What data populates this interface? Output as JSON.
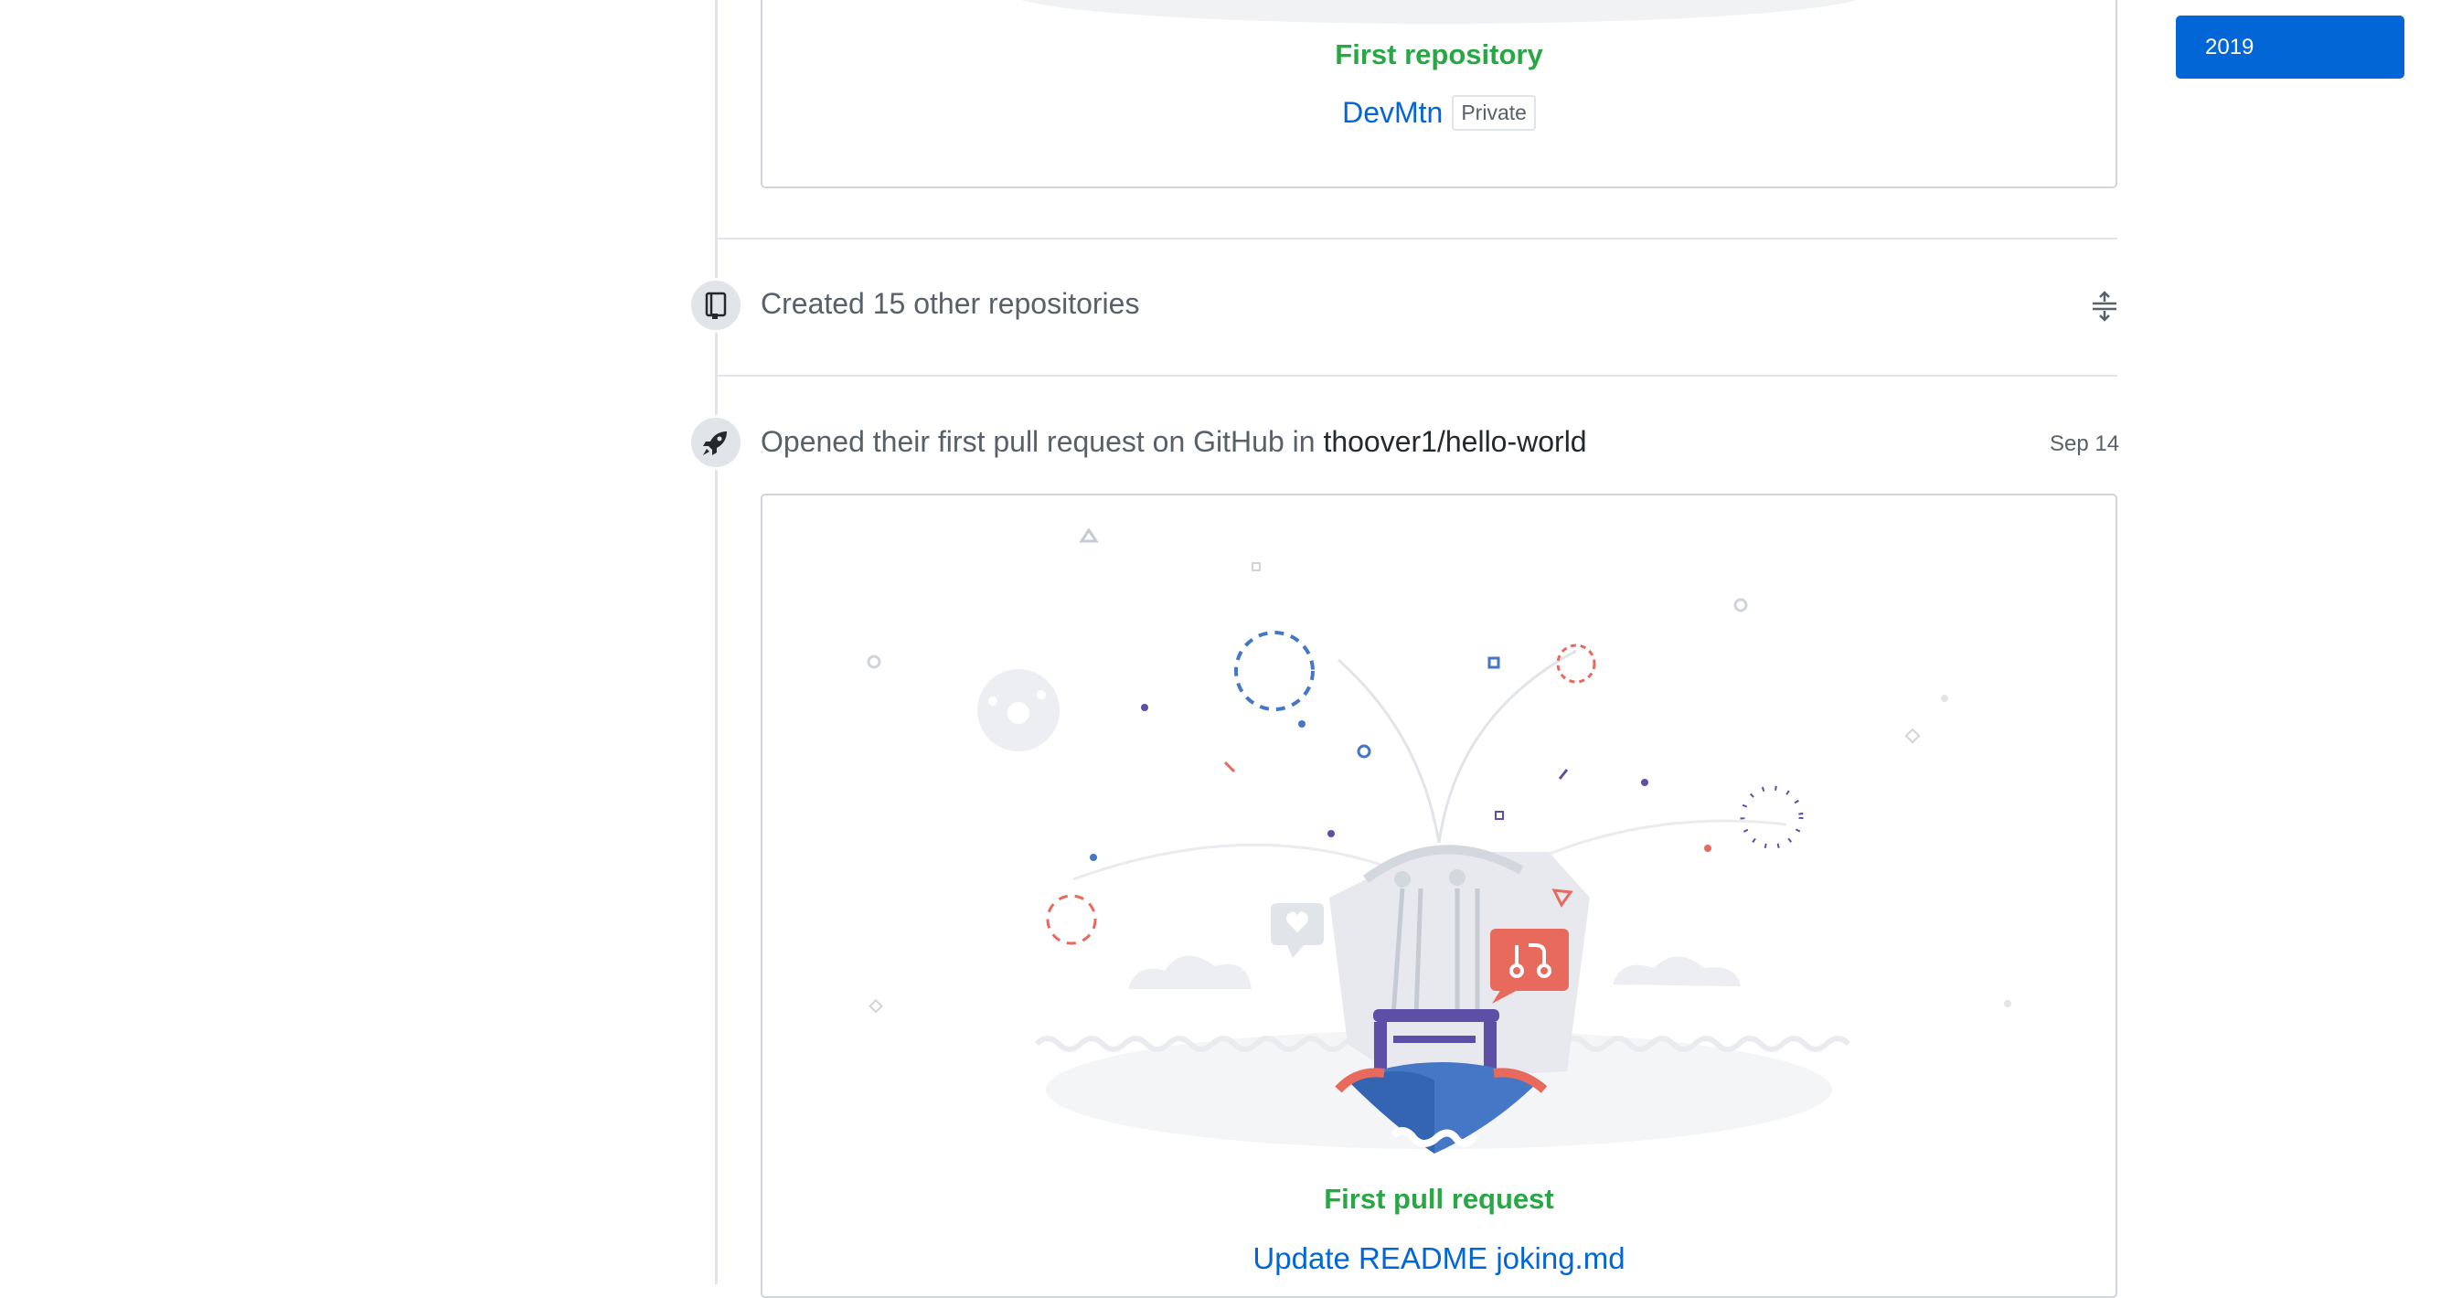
{
  "year_nav": {
    "label": "2019"
  },
  "first_repo_card": {
    "title": "First repository",
    "repo_name": "DevMtn",
    "visibility": "Private"
  },
  "created_event": {
    "text": "Created 15 other repositories",
    "icon": "repo-icon",
    "toggle_icon": "fold-icon"
  },
  "pr_event": {
    "prefix": "Opened their first pull request on GitHub in ",
    "repo": "thoover1/hello-world",
    "date": "Sep 14",
    "icon": "rocket-icon"
  },
  "first_pr_card": {
    "title": "First pull request",
    "pr_title": "Update README joking.md"
  },
  "colors": {
    "green": "#28a745",
    "blue": "#0366d6",
    "border": "#d1d5da",
    "muted": "#586069",
    "coral": "#e86a5c",
    "purple": "#5d4fa6"
  }
}
